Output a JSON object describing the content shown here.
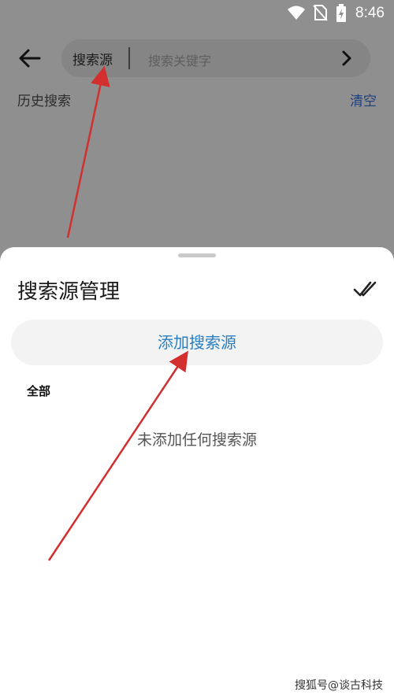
{
  "status": {
    "time": "8:46"
  },
  "header": {
    "source_label": "搜索源",
    "search_placeholder": "搜索关键字",
    "history_title": "历史搜索",
    "clear_label": "清空"
  },
  "sheet": {
    "title": "搜索源管理",
    "add_button": "添加搜索源",
    "group_label": "全部",
    "empty_message": "未添加任何搜索源"
  },
  "watermark": "搜狐号@谈古科技",
  "colors": {
    "accent": "#2a7ec2",
    "clear_link": "#1e3f80",
    "arrow": "#d32f2f"
  }
}
